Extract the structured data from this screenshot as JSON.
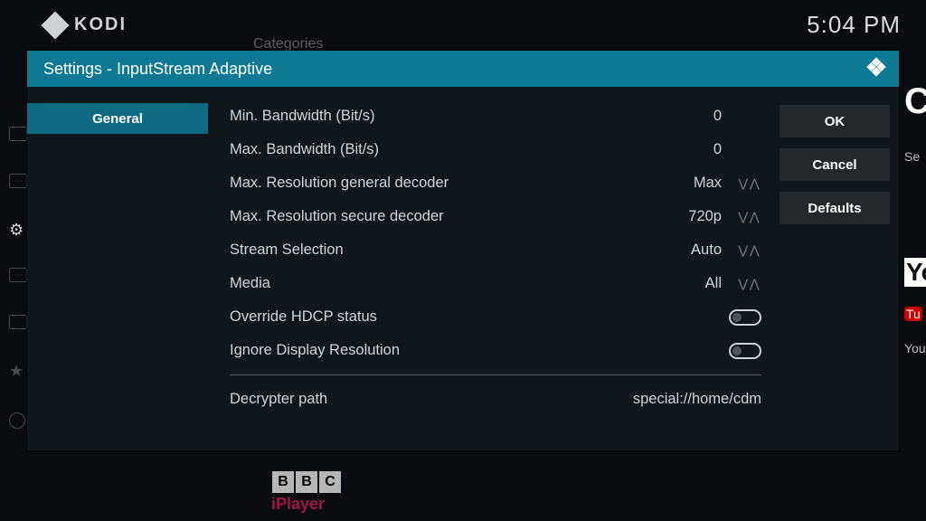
{
  "topbar": {
    "brand": "KODI",
    "clock": "5:04 PM",
    "categories_hint": "Categories"
  },
  "background_right": {
    "c": "C",
    "se": "Se",
    "yo": "Yo",
    "tu": "Tu",
    "you": "You"
  },
  "bbc": {
    "b1": "B",
    "b2": "B",
    "b3": "C",
    "iplayer": "iPlayer"
  },
  "dialog": {
    "title": "Settings - InputStream Adaptive",
    "category": "General",
    "buttons": {
      "ok": "OK",
      "cancel": "Cancel",
      "defaults": "Defaults"
    },
    "rows": {
      "minbw": {
        "label": "Min. Bandwidth (Bit/s)",
        "value": "0"
      },
      "maxbw": {
        "label": "Max. Bandwidth (Bit/s)",
        "value": "0"
      },
      "maxresg": {
        "label": "Max. Resolution general decoder",
        "value": "Max"
      },
      "maxress": {
        "label": "Max. Resolution secure decoder",
        "value": "720p"
      },
      "streamsel": {
        "label": "Stream Selection",
        "value": "Auto"
      },
      "media": {
        "label": "Media",
        "value": "All"
      },
      "hdcp": {
        "label": "Override HDCP status"
      },
      "igndisp": {
        "label": "Ignore Display Resolution"
      },
      "decpath": {
        "label": "Decrypter path",
        "value": "special://home/cdm"
      }
    }
  }
}
